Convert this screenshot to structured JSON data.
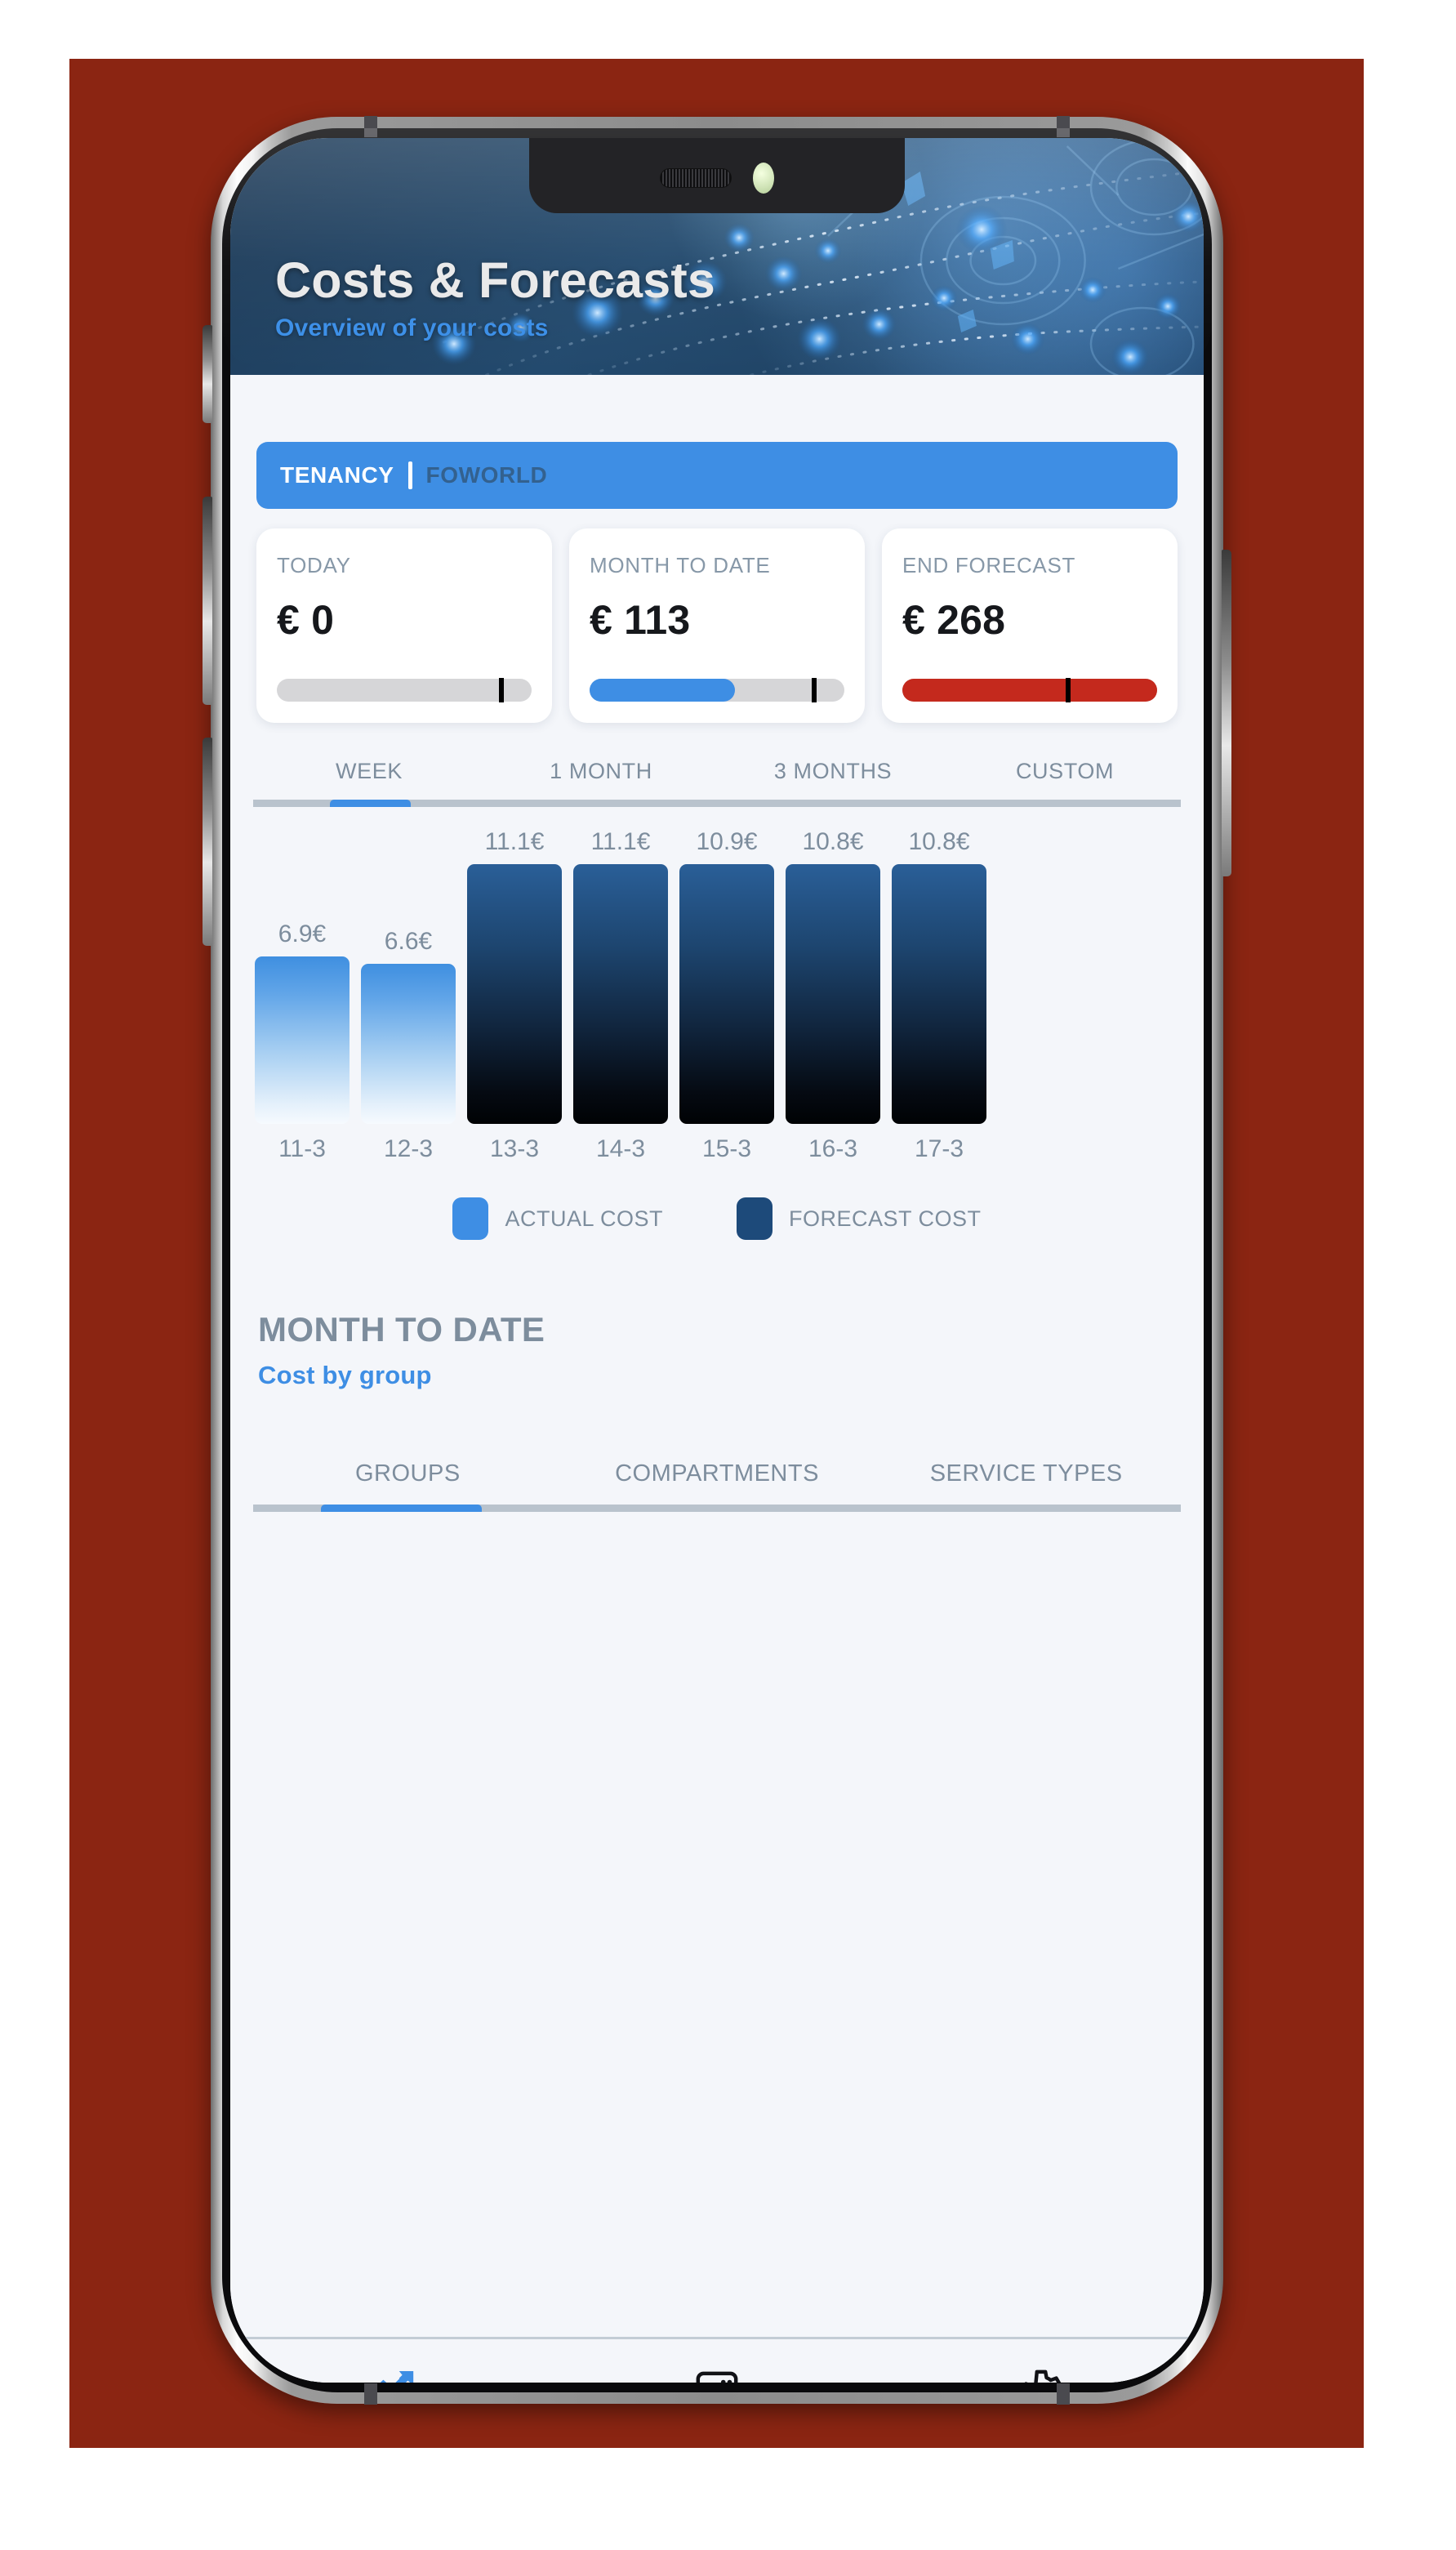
{
  "header": {
    "title": "Costs & Forecasts",
    "subtitle": "Overview of your costs"
  },
  "tenancy": {
    "label": "TENANCY",
    "divider": "|",
    "value": "FOWORLD"
  },
  "summary_cards": [
    {
      "label": "TODAY",
      "value": "€ 0",
      "fill_percent": 0,
      "marker_percent": 88,
      "fill_color": "#d6d6d8"
    },
    {
      "label": "MONTH TO DATE",
      "value": "€ 113",
      "fill_percent": 57,
      "marker_percent": 88,
      "fill_color": "#3e8ee4"
    },
    {
      "label": "END FORECAST",
      "value": "€ 268",
      "fill_percent": 100,
      "marker_percent": 65,
      "fill_color": "#c4291d"
    }
  ],
  "period_tabs": {
    "items": [
      "WEEK",
      "1 MONTH",
      "3 MONTHS",
      "CUSTOM"
    ],
    "active_index": 0
  },
  "chart_data": {
    "type": "bar",
    "title": "",
    "xlabel": "",
    "ylabel": "",
    "categories": [
      "11-3",
      "12-3",
      "13-3",
      "14-3",
      "15-3",
      "16-3",
      "17-3"
    ],
    "values": [
      6.9,
      6.6,
      11.1,
      11.1,
      10.9,
      10.8,
      10.8
    ],
    "value_labels": [
      "6.9€",
      "6.6€",
      "11.1€",
      "11.1€",
      "10.9€",
      "10.8€",
      "10.8€"
    ],
    "series_kind": [
      "actual",
      "actual",
      "forecast",
      "forecast",
      "forecast",
      "forecast",
      "forecast"
    ],
    "ylim": [
      0,
      11.1
    ],
    "grid": false,
    "legend_position": "bottom",
    "legend": [
      {
        "label": "ACTUAL COST",
        "color": "#3e8ee4"
      },
      {
        "label": "FORECAST COST",
        "color": "#1d4a7a"
      }
    ]
  },
  "month_to_date_section": {
    "title": "MONTH TO DATE",
    "subtitle": "Cost by group"
  },
  "group_tabs": {
    "items": [
      "GROUPS",
      "COMPARTMENTS",
      "SERVICE TYPES"
    ],
    "active_index": 0
  },
  "bottom_nav": {
    "items": [
      {
        "icon": "cost-analytics-icon",
        "active": true,
        "color": "#3e8ee4"
      },
      {
        "icon": "database-icon",
        "active": false,
        "color": "#111216"
      },
      {
        "icon": "gear-icon",
        "active": false,
        "color": "#111216"
      }
    ]
  },
  "colors": {
    "backdrop": "#8b2512",
    "accent": "#3e8ee4",
    "screen_bg": "#f4f6fa",
    "muted_text": "#7d8d9d",
    "danger": "#c4291d",
    "forecast_dark": "#1d4a7a"
  }
}
